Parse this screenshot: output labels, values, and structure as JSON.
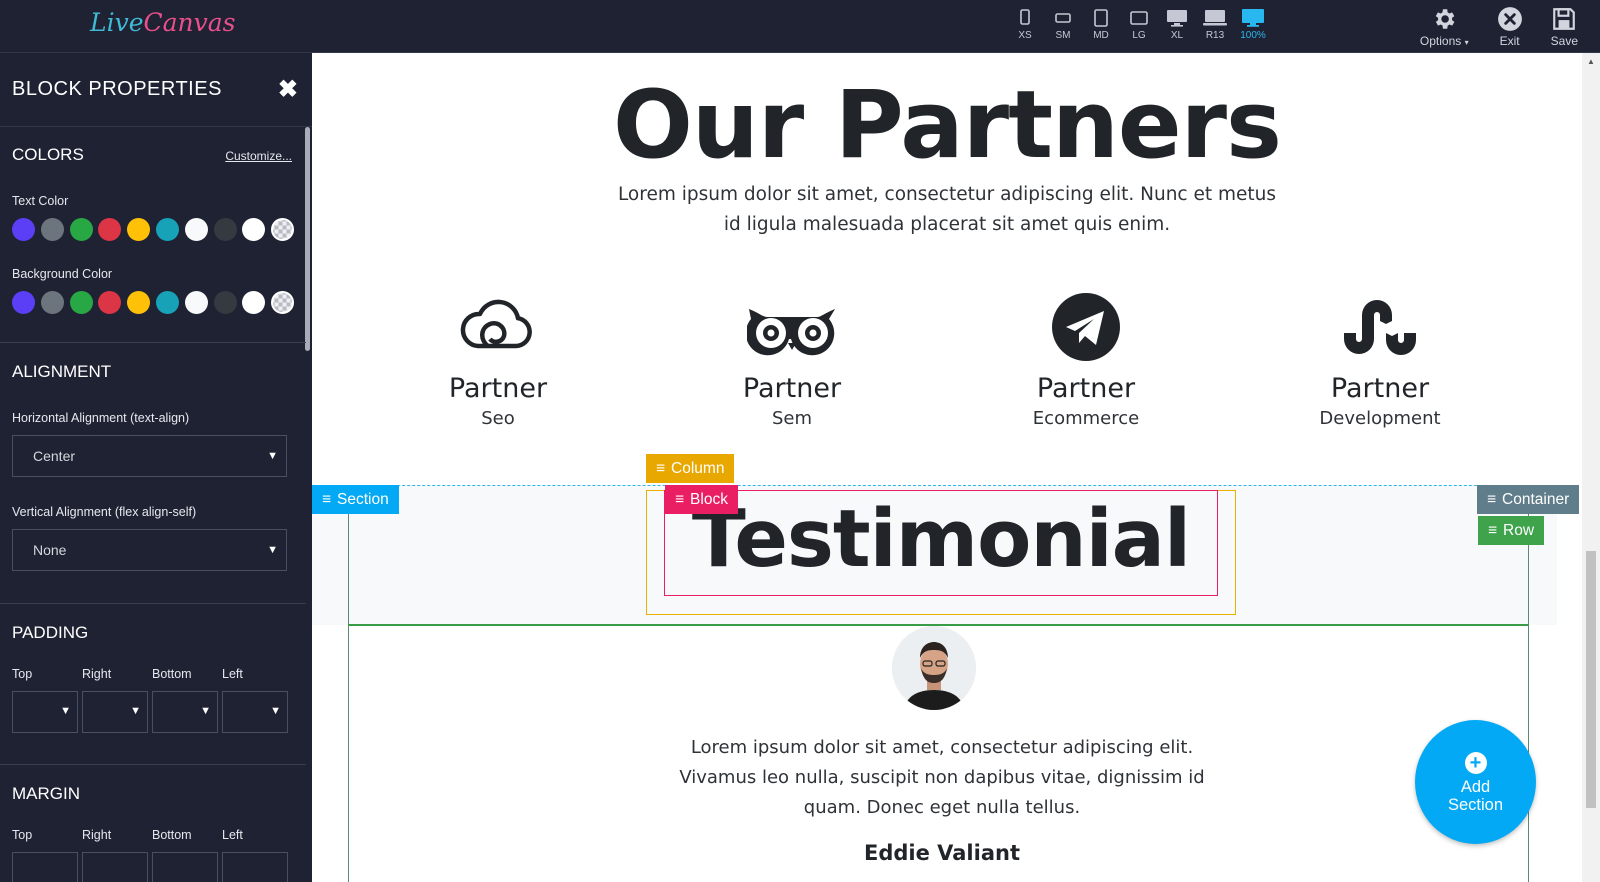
{
  "app": {
    "logo_part1": "Live",
    "logo_part2": "Canvas"
  },
  "devices": [
    {
      "label": "XS"
    },
    {
      "label": "SM"
    },
    {
      "label": "MD"
    },
    {
      "label": "LG"
    },
    {
      "label": "XL"
    },
    {
      "label": "R13"
    },
    {
      "label": "100%"
    }
  ],
  "tools": {
    "options": "Options",
    "options_caret": "▾",
    "exit": "Exit",
    "save": "Save"
  },
  "sidebar": {
    "title": "BLOCK PROPERTIES",
    "colors": {
      "title": "COLORS",
      "customize": "Customize...",
      "text_color_label": "Text Color",
      "background_color_label": "Background Color",
      "swatches": [
        "#5b3ff6",
        "#6c757d",
        "#28a745",
        "#dc3545",
        "#ffc107",
        "#17a2b8",
        "#f8f9fa",
        "#343a40",
        "#ffffff",
        "transparent"
      ]
    },
    "alignment": {
      "title": "ALIGNMENT",
      "horizontal_label": "Horizontal Alignment (text-align)",
      "horizontal_value": "Center",
      "vertical_label": "Vertical Alignment (flex align-self)",
      "vertical_value": "None"
    },
    "padding": {
      "title": "PADDING",
      "top": "Top",
      "right": "Right",
      "bottom": "Bottom",
      "left": "Left"
    },
    "margin": {
      "title": "MARGIN",
      "top": "Top",
      "right": "Right",
      "bottom": "Bottom",
      "left": "Left"
    }
  },
  "page": {
    "title": "Our Partners",
    "lead": "Lorem ipsum dolor sit amet, consectetur adipiscing elit. Nunc et metus id ligula malesuada placerat sit amet quis enim.",
    "partners": [
      {
        "icon": "cloud-icon",
        "title": "Partner",
        "subtitle": "Seo"
      },
      {
        "icon": "owl-icon",
        "title": "Partner",
        "subtitle": "Sem"
      },
      {
        "icon": "paper-plane-icon",
        "title": "Partner",
        "subtitle": "Ecommerce"
      },
      {
        "icon": "stumbleupon-icon",
        "title": "Partner",
        "subtitle": "Development"
      }
    ],
    "testimonial_heading": "Testimonial",
    "quote": "Lorem ipsum dolor sit amet, consectetur adipiscing elit. Vivamus leo nulla, suscipit non dapibus vitae, dignissim id quam. Donec eget nulla tellus.",
    "author": "Eddie Valiant"
  },
  "editor_tags": {
    "section": "Section",
    "column": "Column",
    "block": "Block",
    "container": "Container",
    "row": "Row",
    "colors": {
      "section": "#03a9f4",
      "column": "#e9a800",
      "block": "#e91e63",
      "container": "#607d8b",
      "row": "#3ea34a"
    }
  },
  "fab": {
    "line1": "Add",
    "line2": "Section"
  }
}
